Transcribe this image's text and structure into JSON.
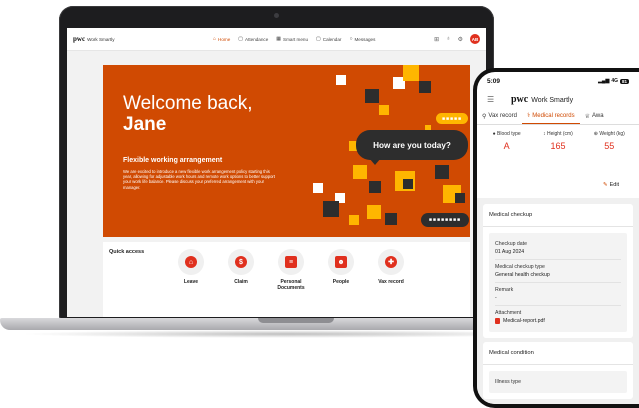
{
  "web": {
    "brand": "pwc",
    "brand_product": "Work Smartly",
    "nav": [
      {
        "label": "Home",
        "icon": "home-icon"
      },
      {
        "label": "Attendance",
        "icon": "calendar-icon"
      },
      {
        "label": "Smart menu",
        "icon": "grid-icon"
      },
      {
        "label": "Calendar",
        "icon": "calendar-icon"
      },
      {
        "label": "Messages",
        "icon": "chat-icon"
      }
    ],
    "avatar_initials": "AB",
    "hero": {
      "greeting": "Welcome back,",
      "name": "Jane",
      "subtitle": "Flexible working arrangement",
      "body": "We are excited to introduce a new flexible work arrangement policy starting this year, allowing for adjustable work hours and remote work options to better support your work life balance. Please discuss your preferred arrangement with your manager.",
      "bubble_text": "How are you today?",
      "pill_dots": "■■■■■■■■",
      "pill_yellow_dots": "■■■■■"
    },
    "quick_access": {
      "title": "Quick access",
      "items": [
        {
          "label": "Leave",
          "icon": "home-icon"
        },
        {
          "label": "Claim",
          "icon": "dollar-icon"
        },
        {
          "label": "Personal Documents",
          "icon": "document-icon"
        },
        {
          "label": "People",
          "icon": "contact-icon"
        },
        {
          "label": "Vax record",
          "icon": "vaccine-icon"
        }
      ]
    }
  },
  "phone": {
    "time": "5:09",
    "signal": "4G",
    "battery": "81",
    "brand": "pwc",
    "brand_product": "Work Smartly",
    "tabs": [
      {
        "label": "Vax record",
        "active": false
      },
      {
        "label": "Medical records",
        "active": true
      },
      {
        "label": "Awa",
        "active": false
      }
    ],
    "metrics": [
      {
        "label": "Blood type",
        "value": "A"
      },
      {
        "label": "Height (cm)",
        "value": "165"
      },
      {
        "label": "Weight (kg)",
        "value": "55"
      }
    ],
    "edit_label": "Edit",
    "medical_checkup": {
      "title": "Medical checkup",
      "fields": [
        {
          "label": "Checkup date",
          "value": "01 Aug 2024"
        },
        {
          "label": "Medical checkup type",
          "value": "General health checkup"
        },
        {
          "label": "Remark",
          "value": "-"
        },
        {
          "label": "Attachment",
          "value": "Medical-report.pdf"
        }
      ]
    },
    "medical_condition": {
      "title": "Medical condition",
      "fields": [
        {
          "label": "Illness type",
          "value": ""
        }
      ]
    }
  },
  "colors": {
    "accent": "#d04a02",
    "red": "#e0301e",
    "yellow": "#ffb600",
    "dark": "#2d2d2d"
  }
}
